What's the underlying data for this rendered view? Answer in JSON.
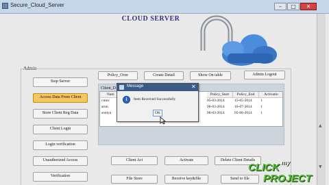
{
  "window": {
    "title": "Secure_Cloud_Server",
    "minimize": "–",
    "maximize": "□",
    "close": "✕"
  },
  "heading": "CLOUD SERVER",
  "admin_label": "Admin",
  "top_buttons": [
    "Policy_Over",
    "Create Detail",
    "Show On table",
    "Admin Logout"
  ],
  "left_buttons": [
    {
      "label": "Stop Server",
      "highlighted": false
    },
    {
      "label": "Access Data From Client",
      "highlighted": true
    },
    {
      "label": "Store Client Reg Data",
      "highlighted": false
    },
    {
      "label": "Client Login",
      "highlighted": false
    },
    {
      "label": "Login verification",
      "highlighted": false
    },
    {
      "label": "Unauthorized Access",
      "highlighted": false
    },
    {
      "label": "Verification",
      "highlighted": false
    }
  ],
  "bottom_buttons_row1": [
    "Client Act",
    "Activate",
    "Delete Client Details"
  ],
  "bottom_buttons_row2": [
    "File Store",
    "Receive key&file",
    "Send to file"
  ],
  "table": {
    "label": "Client_D",
    "columns": [
      "Nam",
      "Policy_Start",
      "Policy_End",
      "Activatio"
    ],
    "rows": [
      [
        "cmoc",
        "05-03-2014",
        "15-05-2014",
        "1"
      ],
      [
        "arun",
        "06-03-2014",
        "16-07-2014",
        "1"
      ],
      [
        "soniya",
        "06-03-2014",
        "05-06-2014",
        "1"
      ]
    ]
  },
  "dialog": {
    "title": "Message",
    "message": "Item Received Successfully",
    "ok": "OK",
    "close": "✕"
  },
  "watermark": {
    "line1": "CLICK",
    "line1b": "my",
    "line2": "PROJECT"
  },
  "colors": {
    "accent": "#f3c65e",
    "heading": "#34307a",
    "cloud": "#3f7fd0"
  }
}
